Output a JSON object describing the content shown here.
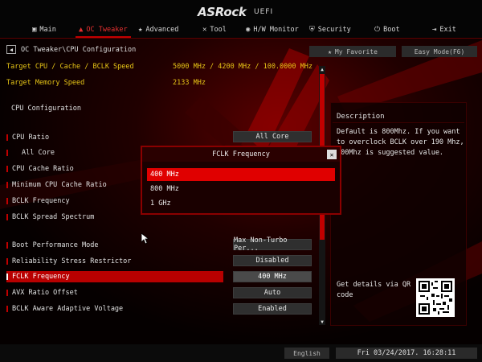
{
  "brand": {
    "logo": "ASRock",
    "uefi": "UEFI"
  },
  "nav": {
    "tabs": [
      {
        "label": "Main",
        "icon": "monitor-icon",
        "active": false
      },
      {
        "label": "OC Tweaker",
        "icon": "tweaker-icon",
        "active": true
      },
      {
        "label": "Advanced",
        "icon": "star-icon",
        "active": false
      },
      {
        "label": "Tool",
        "icon": "tools-icon",
        "active": false
      },
      {
        "label": "H/W Monitor",
        "icon": "hw-monitor-icon",
        "active": false
      },
      {
        "label": "Security",
        "icon": "shield-icon",
        "active": false
      },
      {
        "label": "Boot",
        "icon": "power-icon",
        "active": false
      },
      {
        "label": "Exit",
        "icon": "exit-icon",
        "active": false
      }
    ]
  },
  "breadcrumb": "OC Tweaker\\CPU Configuration",
  "toolbar": {
    "favorite_label": "My Favorite",
    "easy_mode_label": "Easy Mode(F6)"
  },
  "info_rows": [
    {
      "label": "Target CPU / Cache / BCLK Speed",
      "value": "5000 MHz / 4200 MHz / 100.0000 MHz"
    },
    {
      "label": "Target Memory Speed",
      "value": "2133 MHz"
    }
  ],
  "section_title": "CPU Configuration",
  "settings": [
    {
      "label": "CPU Ratio",
      "value": "All Core"
    },
    {
      "label": "All Core",
      "value": ""
    },
    {
      "label": "CPU Cache Ratio",
      "value": ""
    },
    {
      "label": "Minimum CPU Cache Ratio",
      "value": ""
    },
    {
      "label": "BCLK Frequency",
      "value": ""
    },
    {
      "label": "BCLK Spread Spectrum",
      "value": ""
    },
    {
      "label": "Boot Performance Mode",
      "value": "Max Non-Turbo Per..."
    },
    {
      "label": "Reliability Stress Restrictor",
      "value": "Disabled"
    },
    {
      "label": "FCLK Frequency",
      "value": "400 MHz"
    },
    {
      "label": "AVX Ratio Offset",
      "value": "Auto"
    },
    {
      "label": "BCLK Aware Adaptive Voltage",
      "value": "Enabled"
    }
  ],
  "description": {
    "title": "Description",
    "body": "Default is 800Mhz. If you want to overclock BCLK over 190 Mhz, 400Mhz is suggested value.",
    "details": "Get details via QR code"
  },
  "popup": {
    "title": "FCLK Frequency",
    "options": [
      "400 MHz",
      "800 MHz",
      "1 GHz"
    ],
    "selected_index": 0
  },
  "status": {
    "language": "English",
    "datetime": "Fri 03/24/2017. 16:28:11"
  },
  "colors": {
    "accent": "#c20000",
    "info_text": "#e6c416",
    "highlight": "#e00000"
  }
}
